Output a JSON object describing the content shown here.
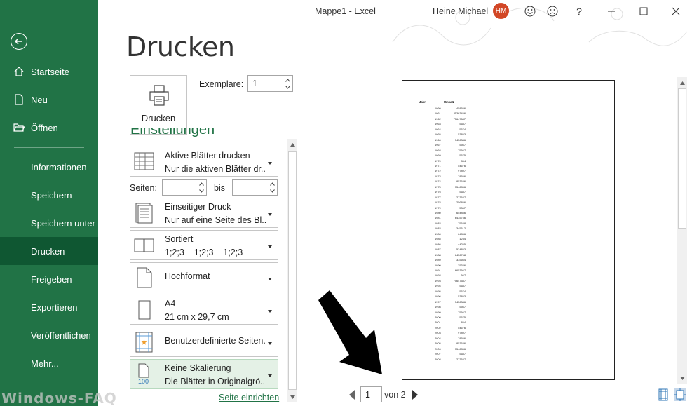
{
  "window": {
    "title": "Mappe1  -  Excel",
    "user_name": "Heine Michael",
    "user_initials": "HM",
    "icons": [
      "smile-icon",
      "frown-icon",
      "help-icon",
      "minimize-icon",
      "maximize-icon",
      "close-icon"
    ],
    "help_label": "?"
  },
  "sidebar": {
    "items": [
      {
        "label": "Startseite",
        "icon": "home-icon"
      },
      {
        "label": "Neu",
        "icon": "new-document-icon"
      },
      {
        "label": "Öffnen",
        "icon": "open-folder-icon"
      },
      {
        "label": "Informationen"
      },
      {
        "label": "Speichern"
      },
      {
        "label": "Speichern unter"
      },
      {
        "label": "Drucken",
        "active": true
      },
      {
        "label": "Freigeben"
      },
      {
        "label": "Exportieren"
      },
      {
        "label": "Veröffentlichen"
      },
      {
        "label": "Mehr..."
      }
    ]
  },
  "print": {
    "title": "Drucken",
    "print_button": "Drucken",
    "copies_label": "Exemplare:",
    "copies_value": "1",
    "settings_heading": "Einstellungen",
    "pages_label": "Seiten:",
    "pages_to_label": "bis",
    "settings": [
      {
        "line1": "Aktive Blätter drucken",
        "line2": "Nur die aktiven Blätter dr..."
      },
      {
        "line1": "Einseitiger Druck",
        "line2": "Nur auf eine Seite des Bl..."
      },
      {
        "line1": "Sortiert",
        "line2": "1;2;3    1;2;3    1;2;3"
      },
      {
        "line1": "Hochformat",
        "line2": ""
      },
      {
        "line1": "A4",
        "line2": "21 cm x 29,7 cm"
      },
      {
        "line1": "Benutzerdefinierte Seiten...",
        "line2": ""
      },
      {
        "line1": "Keine Skalierung",
        "line2": "Die Blätter in Originalgrö..."
      }
    ],
    "scale_badge": "100",
    "page_setup_link": "Seite einrichten"
  },
  "preview": {
    "header_col1": "Jahr",
    "header_col2": "Umsatz",
    "rows": [
      [
        "1960",
        "458556"
      ],
      [
        "1961",
        "85363456"
      ],
      [
        "1962",
        "75647587"
      ],
      [
        "1963",
        "5687"
      ],
      [
        "1964",
        "5674"
      ],
      [
        "1965",
        "53853"
      ],
      [
        "1966",
        "3456346"
      ],
      [
        "1967",
        "5567"
      ],
      [
        "1968",
        "75667"
      ],
      [
        "1969",
        "5675"
      ],
      [
        "1970",
        "854"
      ],
      [
        "1971",
        "54676"
      ],
      [
        "1972",
        "97897"
      ],
      [
        "1973",
        "78556"
      ],
      [
        "1974",
        "853636"
      ],
      [
        "1975",
        "3546856"
      ],
      [
        "1976",
        "5687"
      ],
      [
        "1977",
        "273547"
      ],
      [
        "1978",
        "256856"
      ],
      [
        "1979",
        "5367"
      ],
      [
        "1980",
        "654856"
      ],
      [
        "1981",
        "6435756"
      ],
      [
        "1982",
        "75648"
      ],
      [
        "1983",
        "345612"
      ],
      [
        "1984",
        "64856"
      ],
      [
        "1985",
        "1234"
      ],
      [
        "1986",
        "44255"
      ],
      [
        "1987",
        "534853"
      ],
      [
        "1988",
        "6456768"
      ],
      [
        "1989",
        "335664"
      ],
      [
        "1990",
        "35326"
      ],
      [
        "1991",
        "6653667"
      ],
      [
        "1992",
        "567"
      ],
      [
        "1993",
        "75647587"
      ],
      [
        "1994",
        "5687"
      ],
      [
        "1995",
        "5674"
      ],
      [
        "1996",
        "53853"
      ],
      [
        "1997",
        "3456346"
      ],
      [
        "1998",
        "5567"
      ],
      [
        "1999",
        "75667"
      ],
      [
        "2000",
        "5675"
      ],
      [
        "2001",
        "854"
      ],
      [
        "2002",
        "54676"
      ],
      [
        "2003",
        "97897"
      ],
      [
        "2004",
        "78556"
      ],
      [
        "2005",
        "853636"
      ],
      [
        "2006",
        "3546856"
      ],
      [
        "2007",
        "5687"
      ],
      [
        "2008",
        "273547"
      ]
    ],
    "current_page": "1",
    "page_of": "von 2"
  },
  "watermark": "Windows-FAQ"
}
